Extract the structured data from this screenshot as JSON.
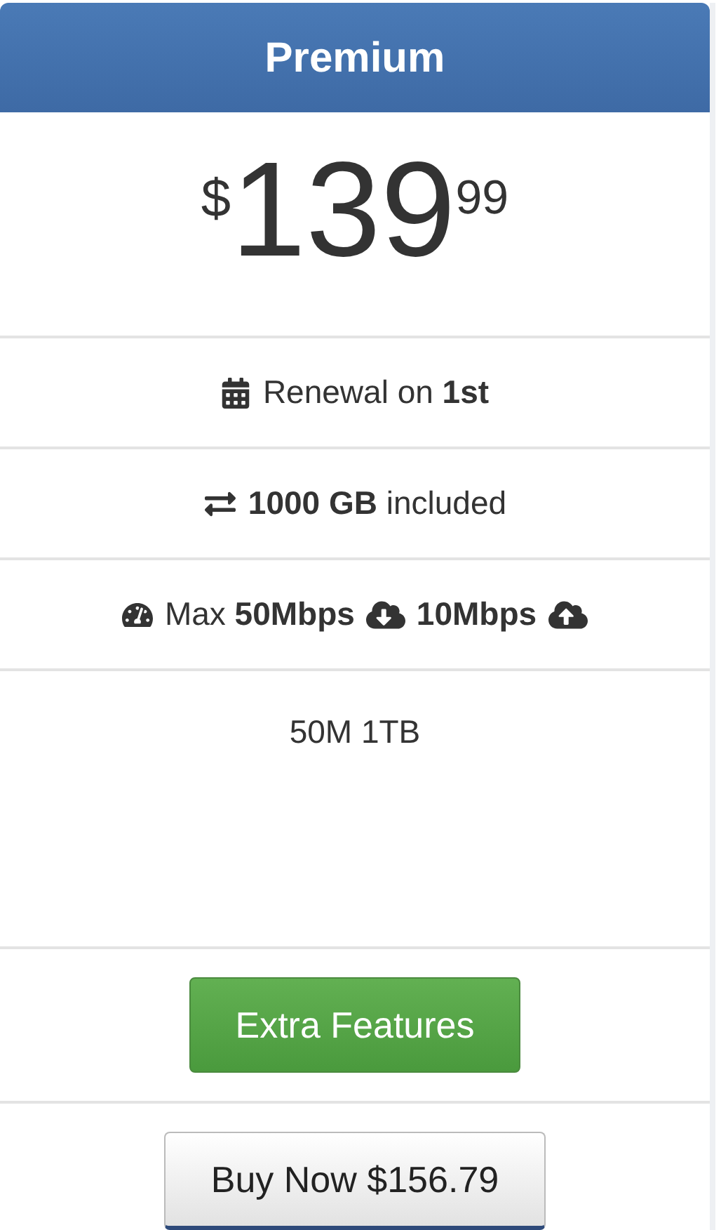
{
  "plan": {
    "title": "Premium",
    "price": {
      "currency": "$",
      "amount": "139",
      "cents": "99"
    },
    "features": [
      {
        "kind": "renewal",
        "text": "Renewal on **1st**"
      },
      {
        "kind": "bandwidth",
        "text": "**1000 GB** included"
      },
      {
        "kind": "speed",
        "download": "Max **50Mbps**",
        "upload": "**10Mbps**"
      }
    ],
    "description": "50M 1TB",
    "buttons": [
      {
        "kind": "extra",
        "label": "Extra Features"
      },
      {
        "kind": "buy",
        "label": "Buy Now $156.79"
      }
    ]
  }
}
